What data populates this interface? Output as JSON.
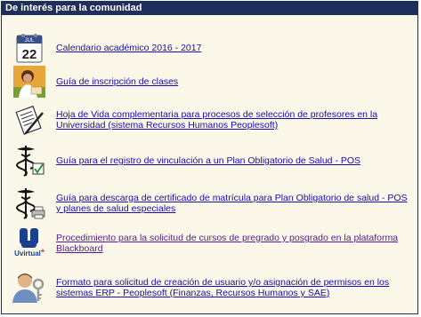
{
  "panel": {
    "title": "De interés para la comunidad"
  },
  "items": [
    {
      "label": "Calendario académico 2016 - 2017",
      "icon": "calendar-icon",
      "visited": false
    },
    {
      "label": "Guía de inscripción de clases",
      "icon": "student-photo-icon",
      "visited": false
    },
    {
      "label": "Hoja de Vida complementaria para procesos de selección de profesores en la Universidad (sistema Recursos Humanos Peoplesoft)",
      "icon": "document-pen-icon",
      "visited": false
    },
    {
      "label": "Guía para el registro de vinculación a un Plan Obligatorio de Salud - POS",
      "icon": "caduceus-check-icon",
      "visited": false
    },
    {
      "label": "Guía para descarga de certificado de matrícula para Plan Obligatorio de salud - POS y planes de salud especiales",
      "icon": "caduceus-printer-icon",
      "visited": false
    },
    {
      "label": "Procedimiento para la solicitud de cursos de pregrado y posgrado en la plataforma Blackboard",
      "icon": "uvirtual-logo-icon",
      "visited": true
    },
    {
      "label": "Formato para solicitud de creación de usuario y/o asignación de permisos en los sistemas ERP - Peoplesoft (Finanzas, Recursos Humanos y SAE)",
      "icon": "user-key-icon",
      "visited": false
    }
  ],
  "calendar_icon": {
    "month": "JUL",
    "day": "22"
  },
  "uvirtual_logo": {
    "text": "Uvirtual"
  }
}
